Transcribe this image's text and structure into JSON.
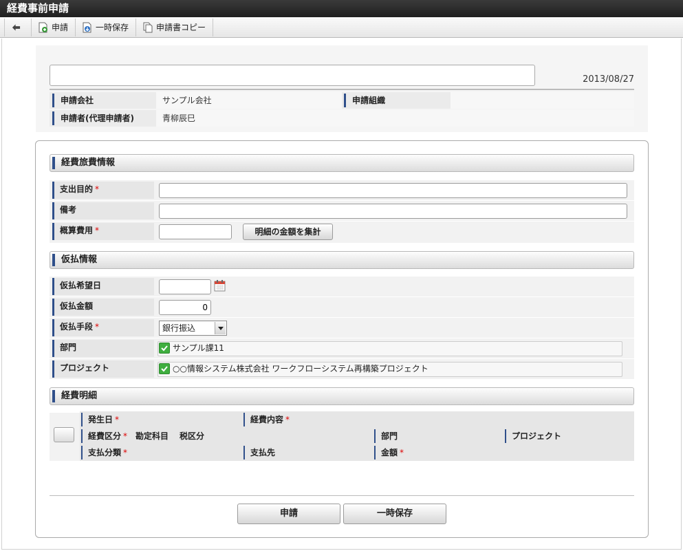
{
  "window_title": "経費事前申請",
  "toolbar": {
    "back_label": "",
    "apply_label": "申請",
    "temp_save_label": "一時保存",
    "copy_label": "申請書コピー"
  },
  "header": {
    "title_value": "",
    "date": "2013/08/27",
    "company_label": "申請会社",
    "company_value": "サンプル会社",
    "org_label": "申請組織",
    "org_value": "",
    "applicant_label": "申請者(代理申請者)",
    "applicant_value": "青柳辰巳"
  },
  "expense_info": {
    "section_title": "経費旅費情報",
    "purpose_label": "支出目的",
    "purpose_value": "",
    "remarks_label": "備考",
    "remarks_value": "",
    "estimate_label": "概算費用",
    "estimate_value": "",
    "sum_button_label": "明細の金額を集計"
  },
  "advance_info": {
    "section_title": "仮払情報",
    "date_label": "仮払希望日",
    "date_value": "",
    "amount_label": "仮払金額",
    "amount_value": "0",
    "method_label": "仮払手段",
    "method_value": "銀行振込",
    "dept_label": "部門",
    "dept_value": "サンプル課11",
    "project_label": "プロジェクト",
    "project_value": "○○情報システム株式会社 ワークフローシステム再構築プロジェクト"
  },
  "detail": {
    "section_title": "経費明細",
    "occur_date_label": "発生日",
    "content_label": "経費内容",
    "category_label": "経費区分",
    "account_label": "勘定科目",
    "tax_label": "税区分",
    "dept_label": "部門",
    "project_label": "プロジェクト",
    "payment_type_label": "支払分類",
    "payee_label": "支払先",
    "amount_label": "金額"
  },
  "required_mark": "*",
  "footer": {
    "apply_label": "申請",
    "temp_save_label": "一時保存"
  },
  "colors": {
    "accent_bar": "#2f4f8a",
    "required": "#dd0000",
    "check_green": "#3fae3f"
  }
}
